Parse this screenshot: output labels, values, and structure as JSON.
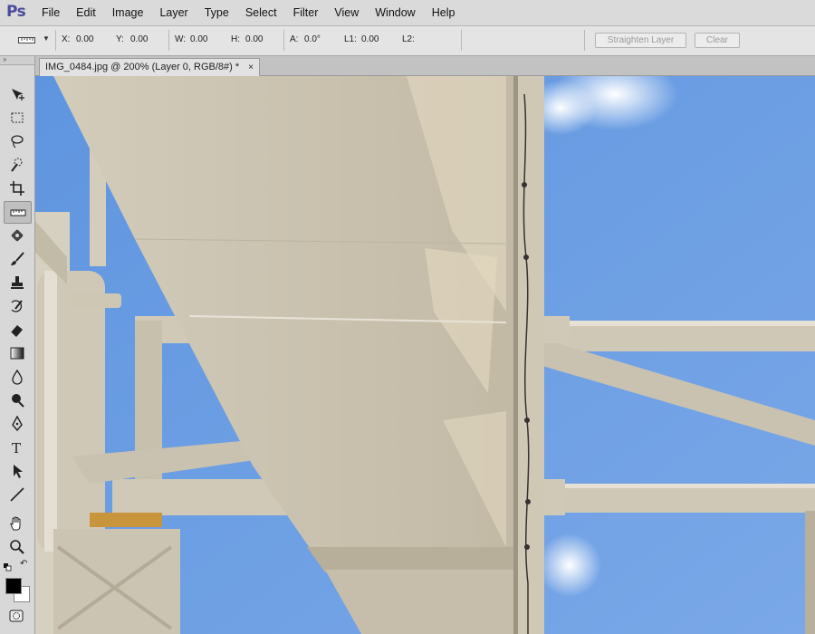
{
  "app": {
    "logo": "Ps"
  },
  "menu": [
    "File",
    "Edit",
    "Image",
    "Layer",
    "Type",
    "Select",
    "Filter",
    "View",
    "Window",
    "Help"
  ],
  "options_bar": {
    "x_label": "X:",
    "x_value": "0.00",
    "y_label": "Y:",
    "y_value": "0.00",
    "w_label": "W:",
    "w_value": "0.00",
    "h_label": "H:",
    "h_value": "0.00",
    "a_label": "A:",
    "a_value": "0.0°",
    "l1_label": "L1:",
    "l1_value": "0.00",
    "l2_label": "L2:",
    "l2_value": "",
    "straighten_label": "Straighten Layer",
    "clear_label": "Clear"
  },
  "toolbox": {
    "collapse_glyph": "»"
  },
  "document_tab": {
    "title": "IMG_0484.jpg @ 200% (Layer 0, RGB/8#) *",
    "close": "×"
  },
  "colors": {
    "sky": "#6c9ee3",
    "structure": "#c9c2b0",
    "shadow": "#b3aa98",
    "accent_logo": "#4b4b9b"
  },
  "tools": [
    "move-icon",
    "marquee-icon",
    "lasso-icon",
    "quick-select-icon",
    "crop-icon",
    "ruler-icon",
    "healing-icon",
    "brush-icon",
    "stamp-icon",
    "history-brush-icon",
    "eraser-icon",
    "gradient-icon",
    "blur-icon",
    "dodge-icon",
    "pen-icon",
    "type-icon",
    "path-select-icon",
    "line-icon",
    "hand-icon",
    "zoom-icon"
  ]
}
